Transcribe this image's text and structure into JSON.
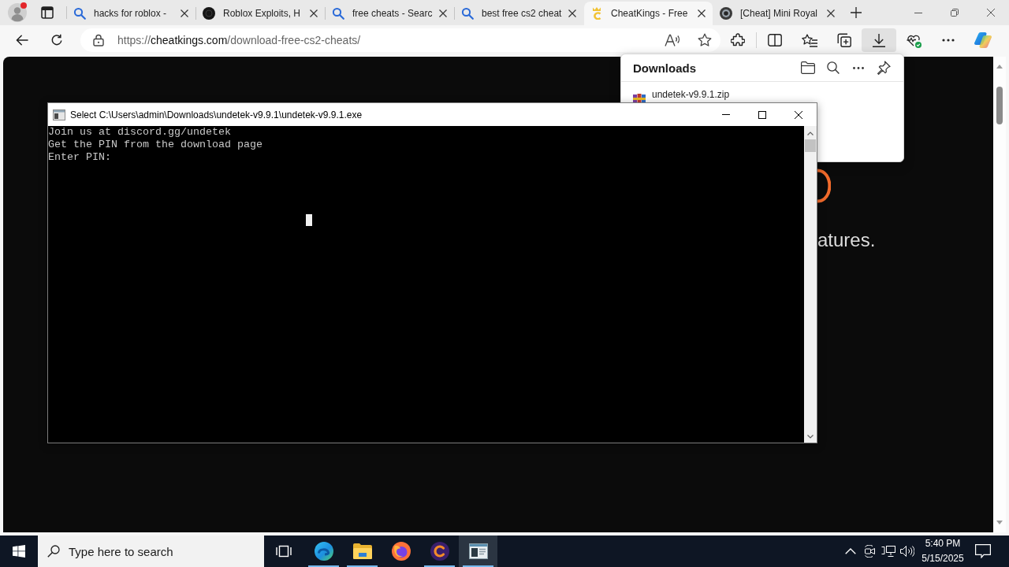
{
  "browser": {
    "profile": {
      "alert": true
    },
    "tabs": [
      {
        "title": "hacks for roblox -",
        "kind": "search",
        "selected": false
      },
      {
        "title": "Roblox Exploits, H",
        "kind": "dark-disc",
        "selected": false
      },
      {
        "title": "free cheats - Searc",
        "kind": "search",
        "selected": false
      },
      {
        "title": "best free cs2 cheat",
        "kind": "search",
        "selected": false
      },
      {
        "title": "CheatKings - Free",
        "kind": "crown",
        "selected": true
      },
      {
        "title": "[Cheat] Mini Royal",
        "kind": "emblem",
        "selected": false
      }
    ],
    "address_bar": {
      "url": "https://**cheatkings.com**/download-free-cs2-cheats/"
    },
    "toolbar": [
      {
        "kind": "extensions",
        "pressed": false
      },
      {
        "kind": "split-screen",
        "pressed": false
      },
      {
        "kind": "favorites",
        "pressed": false
      },
      {
        "kind": "collections",
        "pressed": false
      },
      {
        "kind": "downloads",
        "pressed": true
      },
      {
        "kind": "essentials",
        "pressed": false
      },
      {
        "kind": "more",
        "pressed": false
      },
      {
        "kind": "copilot",
        "pressed": false
      }
    ]
  },
  "page": {
    "visible_text": "atures."
  },
  "downloads_panel": {
    "title": "Downloads",
    "items": [
      {
        "filename": "undetek-v9.9.1.zip"
      }
    ]
  },
  "console_window": {
    "title": "Select C:\\Users\\admin\\Downloads\\undetek-v9.9.1\\undetek-v9.9.1.exe",
    "lines": [
      "Join us at discord.gg/undetek",
      "Get the PIN from the download page",
      "Enter PIN:"
    ]
  },
  "taskbar": {
    "search": {
      "placeholder": "Type here to search"
    },
    "apps": [
      {
        "kind": "swirl",
        "running": true,
        "active": false
      },
      {
        "kind": "folder",
        "running": true,
        "active": false
      },
      {
        "kind": "fox",
        "running": false,
        "active": false
      },
      {
        "kind": "ring-c",
        "running": true,
        "active": false
      },
      {
        "kind": "terminal",
        "running": true,
        "active": true
      }
    ],
    "clock": {
      "time": "5:40 PM",
      "date": "5/15/2025"
    }
  }
}
